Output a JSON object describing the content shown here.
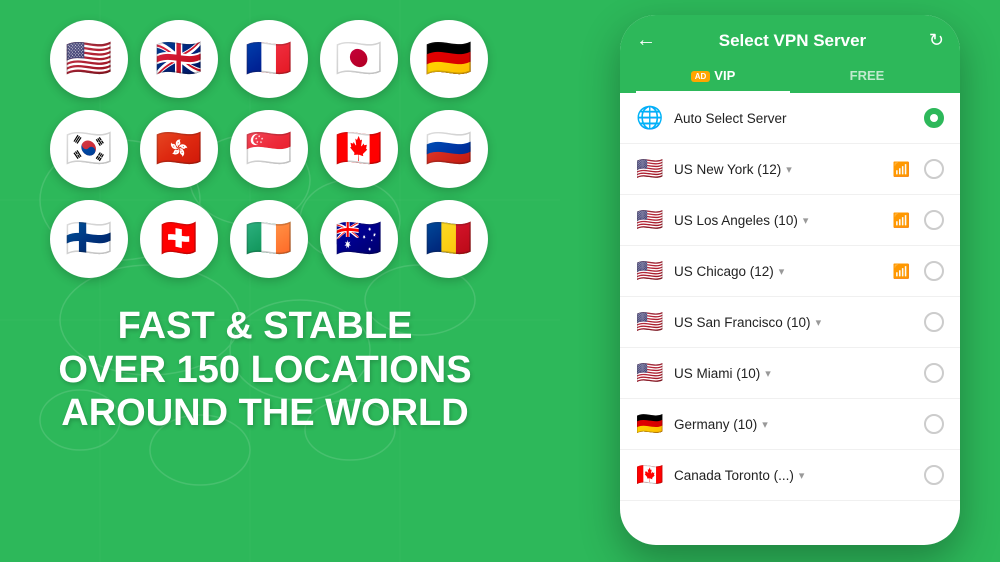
{
  "background_color": "#2db85a",
  "left": {
    "flags": [
      {
        "emoji": "🇺🇸",
        "name": "usa-flag"
      },
      {
        "emoji": "🇬🇧",
        "name": "uk-flag"
      },
      {
        "emoji": "🇫🇷",
        "name": "france-flag"
      },
      {
        "emoji": "🇯🇵",
        "name": "japan-flag"
      },
      {
        "emoji": "🇩🇪",
        "name": "germany-flag"
      },
      {
        "emoji": "🇰🇷",
        "name": "korea-flag"
      },
      {
        "emoji": "🇭🇰",
        "name": "hongkong-flag"
      },
      {
        "emoji": "🇸🇬",
        "name": "singapore-flag"
      },
      {
        "emoji": "🇨🇦",
        "name": "canada-flag"
      },
      {
        "emoji": "🇷🇺",
        "name": "russia-flag"
      },
      {
        "emoji": "🇫🇮",
        "name": "finland-flag"
      },
      {
        "emoji": "🇨🇭",
        "name": "switzerland-flag"
      },
      {
        "emoji": "🇮🇪",
        "name": "ireland-flag"
      },
      {
        "emoji": "🇦🇺",
        "name": "australia-flag"
      },
      {
        "emoji": "🇷🇴",
        "name": "romania-flag"
      }
    ],
    "hero_line1": "FAST & STABLE",
    "hero_line2": "OVER 150 LOCATIONS",
    "hero_line3": "AROUND THE WORLD"
  },
  "phone": {
    "header": {
      "back_label": "←",
      "title": "Select VPN Server",
      "refresh_label": "↻"
    },
    "tabs": [
      {
        "label": "VIP",
        "badge": "AD",
        "active": true
      },
      {
        "label": "FREE",
        "active": false
      }
    ],
    "servers": [
      {
        "flag": "🌐",
        "name": "Auto Select Server",
        "signal": false,
        "selected": true,
        "chevron": false,
        "type": "auto"
      },
      {
        "flag": "🇺🇸",
        "name": "US New York (12)",
        "signal": true,
        "selected": false,
        "chevron": true,
        "type": "us"
      },
      {
        "flag": "🇺🇸",
        "name": "US Los Angeles (10)",
        "signal": true,
        "selected": false,
        "chevron": true,
        "type": "us"
      },
      {
        "flag": "🇺🇸",
        "name": "US Chicago (12)",
        "signal": true,
        "selected": false,
        "chevron": true,
        "type": "us"
      },
      {
        "flag": "🇺🇸",
        "name": "US San Francisco (10)",
        "signal": false,
        "selected": false,
        "chevron": true,
        "type": "us"
      },
      {
        "flag": "🇺🇸",
        "name": "US Miami (10)",
        "signal": false,
        "selected": false,
        "chevron": true,
        "type": "us"
      },
      {
        "flag": "🇩🇪",
        "name": "Germany (10)",
        "signal": false,
        "selected": false,
        "chevron": true,
        "type": "de"
      },
      {
        "flag": "🇨🇦",
        "name": "Canada Toronto (...)",
        "signal": false,
        "selected": false,
        "chevron": true,
        "type": "ca"
      }
    ]
  }
}
